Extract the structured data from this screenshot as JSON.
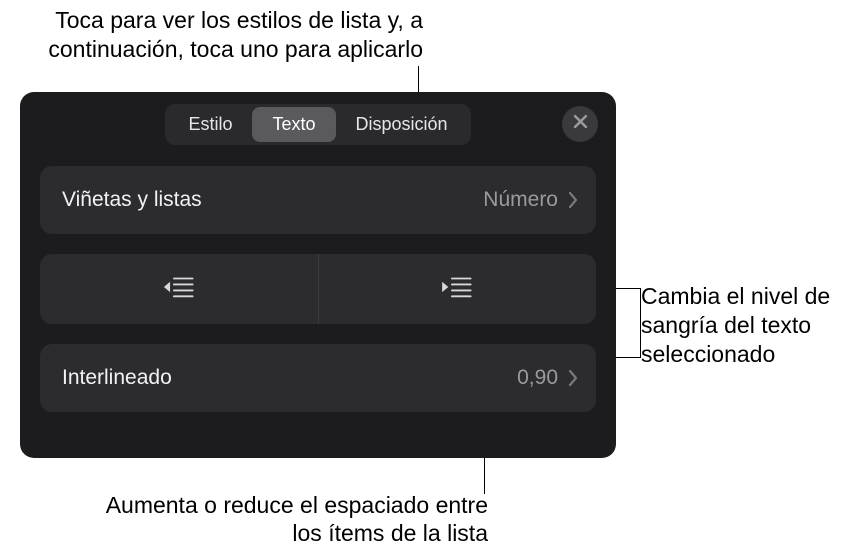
{
  "callouts": {
    "top": "Toca para ver los estilos de lista y, a continuación, toca uno para aplicarlo",
    "right": "Cambia el nivel de sangría del texto seleccionado",
    "bottom": "Aumenta o reduce el espaciado entre los ítems de la lista"
  },
  "tabs": {
    "style": "Estilo",
    "text": "Texto",
    "layout": "Disposición"
  },
  "rows": {
    "bullets_label": "Viñetas y listas",
    "bullets_value": "Número",
    "spacing_label": "Interlineado",
    "spacing_value": "0,90"
  }
}
